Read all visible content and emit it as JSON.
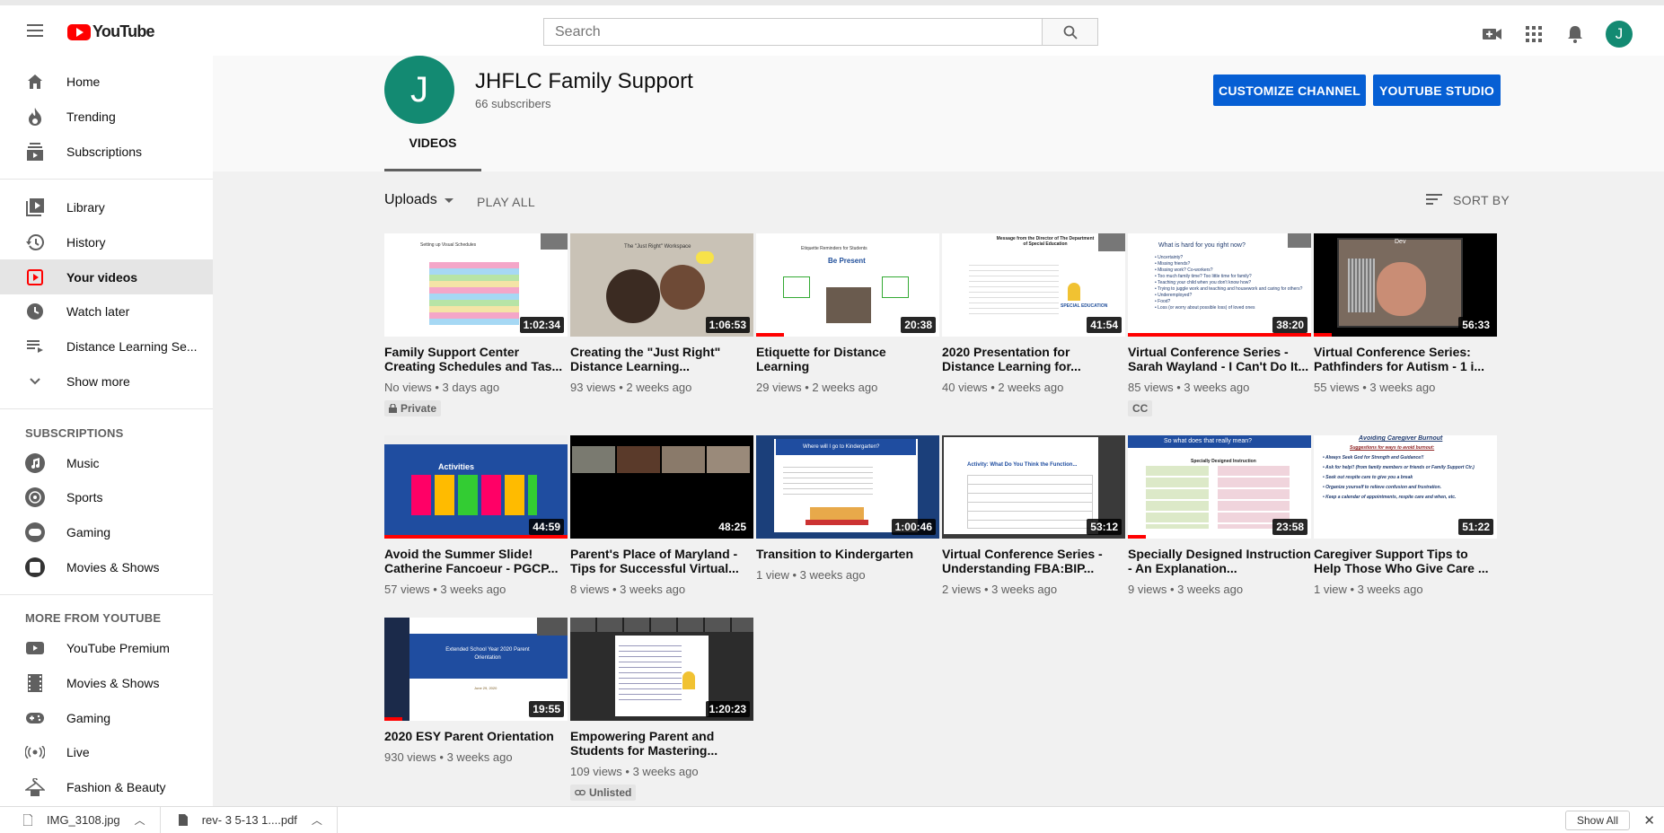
{
  "header": {
    "logo_text": "YouTube",
    "search_placeholder": "Search",
    "avatar_letter": "J"
  },
  "sidebar": {
    "main": [
      {
        "label": "Home",
        "icon": "home-icon"
      },
      {
        "label": "Trending",
        "icon": "trending-icon"
      },
      {
        "label": "Subscriptions",
        "icon": "subscriptions-icon"
      }
    ],
    "library": [
      {
        "label": "Library",
        "icon": "library-icon"
      },
      {
        "label": "History",
        "icon": "history-icon"
      },
      {
        "label": "Your videos",
        "icon": "your-videos-icon",
        "active": true
      },
      {
        "label": "Watch later",
        "icon": "watch-later-icon"
      },
      {
        "label": "Distance Learning Se...",
        "icon": "playlist-icon"
      },
      {
        "label": "Show more",
        "icon": "chevron-down-icon"
      }
    ],
    "subscriptions_heading": "SUBSCRIPTIONS",
    "subscriptions": [
      {
        "label": "Music",
        "icon": "music-icon"
      },
      {
        "label": "Sports",
        "icon": "sports-icon"
      },
      {
        "label": "Gaming",
        "icon": "gaming-icon"
      },
      {
        "label": "Movies & Shows",
        "icon": "movies-icon"
      }
    ],
    "more_heading": "MORE FROM YOUTUBE",
    "more": [
      {
        "label": "YouTube Premium",
        "icon": "premium-icon"
      },
      {
        "label": "Movies & Shows",
        "icon": "film-icon"
      },
      {
        "label": "Gaming",
        "icon": "gaming-icon"
      },
      {
        "label": "Live",
        "icon": "live-icon"
      },
      {
        "label": "Fashion & Beauty",
        "icon": "hanger-icon"
      }
    ]
  },
  "channel": {
    "avatar_letter": "J",
    "name": "JHFLC Family Support",
    "subscribers": "66 subscribers",
    "customize_label": "CUSTOMIZE CHANNEL",
    "studio_label": "YOUTUBE STUDIO",
    "tab_label": "VIDEOS"
  },
  "toolbar": {
    "uploads_label": "Uploads",
    "play_all_label": "PLAY ALL",
    "sort_label": "SORT BY"
  },
  "videos": [
    {
      "title": "Family Support Center Creating Schedules and Tas...",
      "meta": "No views • 3 days ago",
      "duration": "1:02:34",
      "badge": "Private",
      "badge_icon": "lock-icon",
      "bg": "#ffffff",
      "progress": 0
    },
    {
      "title": "Creating the \"Just Right\" Distance Learning...",
      "meta": "93 views • 2 weeks ago",
      "duration": "1:06:53",
      "badge": "",
      "bg": "#e8e4dc",
      "progress": 0
    },
    {
      "title": "Etiquette for Distance Learning",
      "meta": "29 views • 2 weeks ago",
      "duration": "20:38",
      "badge": "",
      "bg": "#ffffff",
      "progress": 0.15
    },
    {
      "title": "2020 Presentation for Distance Learning for...",
      "meta": "40 views • 2 weeks ago",
      "duration": "41:54",
      "badge": "",
      "bg": "#ffffff",
      "progress": 0
    },
    {
      "title": "Virtual Conference Series - Sarah Wayland - I Can't Do It...",
      "meta": "85 views • 3 weeks ago",
      "duration": "38:20",
      "badge": "CC",
      "bg": "#ffffff",
      "progress": 1
    },
    {
      "title": "Virtual Conference Series: Pathfinders for Autism - 1 i...",
      "meta": "55 views • 3 weeks ago",
      "duration": "56:33",
      "badge": "",
      "bg": "#1a1a1a",
      "progress": 0.1
    },
    {
      "title": "Avoid the Summer Slide! Catherine Fancoeur - PGCP...",
      "meta": "57 views • 3 weeks ago",
      "duration": "44:59",
      "badge": "",
      "bg": "#2456a8",
      "progress": 1
    },
    {
      "title": "Parent's Place of Maryland - Tips for Successful Virtual...",
      "meta": "8 views • 3 weeks ago",
      "duration": "48:25",
      "badge": "",
      "bg": "#000000",
      "progress": 0
    },
    {
      "title": "Transition to Kindergarten",
      "meta": "1 view • 3 weeks ago",
      "duration": "1:00:46",
      "badge": "",
      "bg": "#ffffff",
      "progress": 0
    },
    {
      "title": "Virtual Conference Series - Understanding FBA:BIP...",
      "meta": "2 views • 3 weeks ago",
      "duration": "53:12",
      "badge": "",
      "bg": "#ffffff",
      "progress": 0
    },
    {
      "title": "Specially Designed Instruction - An Explanation...",
      "meta": "9 views • 3 weeks ago",
      "duration": "23:58",
      "badge": "",
      "bg": "#ffffff",
      "progress": 0.1
    },
    {
      "title": "Caregiver Support Tips to Help Those Who Give Care ...",
      "meta": "1 view • 3 weeks ago",
      "duration": "51:22",
      "badge": "",
      "bg": "#ffffff",
      "progress": 0
    },
    {
      "title": "2020 ESY Parent Orientation",
      "meta": "930 views • 3 weeks ago",
      "duration": "19:55",
      "badge": "",
      "bg": "#ffffff",
      "progress": 0.1
    },
    {
      "title": "Empowering Parent and Students for Mastering...",
      "meta": "109 views • 3 weeks ago",
      "duration": "1:20:23",
      "badge": "Unlisted",
      "badge_icon": "link-icon",
      "bg": "#ffffff",
      "progress": 0
    },
    {
      "thumb_text": {
        "t0": "Setting up Visual Schedules",
        "t1": "The \"Just Right\" Workspace",
        "t2": "Etiquette Reminders for Students",
        "t2b": "Be Present",
        "t3": "Message from the Director of The Department of Special Education",
        "t3b": "SPECIAL EDUCATION",
        "t4": "What is hard for you right now?",
        "t5": "Dev",
        "t6": "Activities",
        "t8": "Where will I go to Kindergarten?",
        "t9": "Activity: What Do You Think the Function...",
        "t10": "So what does that really mean?",
        "t10b": "Specially Designed Instruction",
        "t11": "Avoiding Caregiver Burnout",
        "t11b": "Suggestions for ways to avoid burnout:",
        "t12": "Extended School Year 2020 Parent Orientation",
        "t12b": "June 29, 2020",
        "t4list": "• Uncertainty?\n• Missing friends?\n• Missing work? Co-workers?\n• Too much family time? Too little time for family?\n• Teaching your child when you don't know how?\n• Trying to juggle work and teaching and housework and caring for others?\n• Underemployed?\n• Food?\n• Loss (or worry about possible loss) of loved ones",
        "t11list": "• Always Seek God for Strength and Guidance!!\n• Ask for help!! (from family members or friends or Family Support Ctr.)\n• Seek out respite care to give you a break\n• Organize yourself to relieve confusion and frustration.\n• Keep a calendar of appointments, respite care and when, etc."
      }
    }
  ],
  "downloads": {
    "items": [
      {
        "name": "IMG_3108.jpg",
        "icon": "image-file-icon"
      },
      {
        "name": "rev- 3   5-13 1....pdf",
        "icon": "pdf-file-icon"
      }
    ],
    "show_all_label": "Show All"
  },
  "colors": {
    "accent": "#065fd4",
    "brand": "#ff0000",
    "avatar": "#138a72"
  }
}
